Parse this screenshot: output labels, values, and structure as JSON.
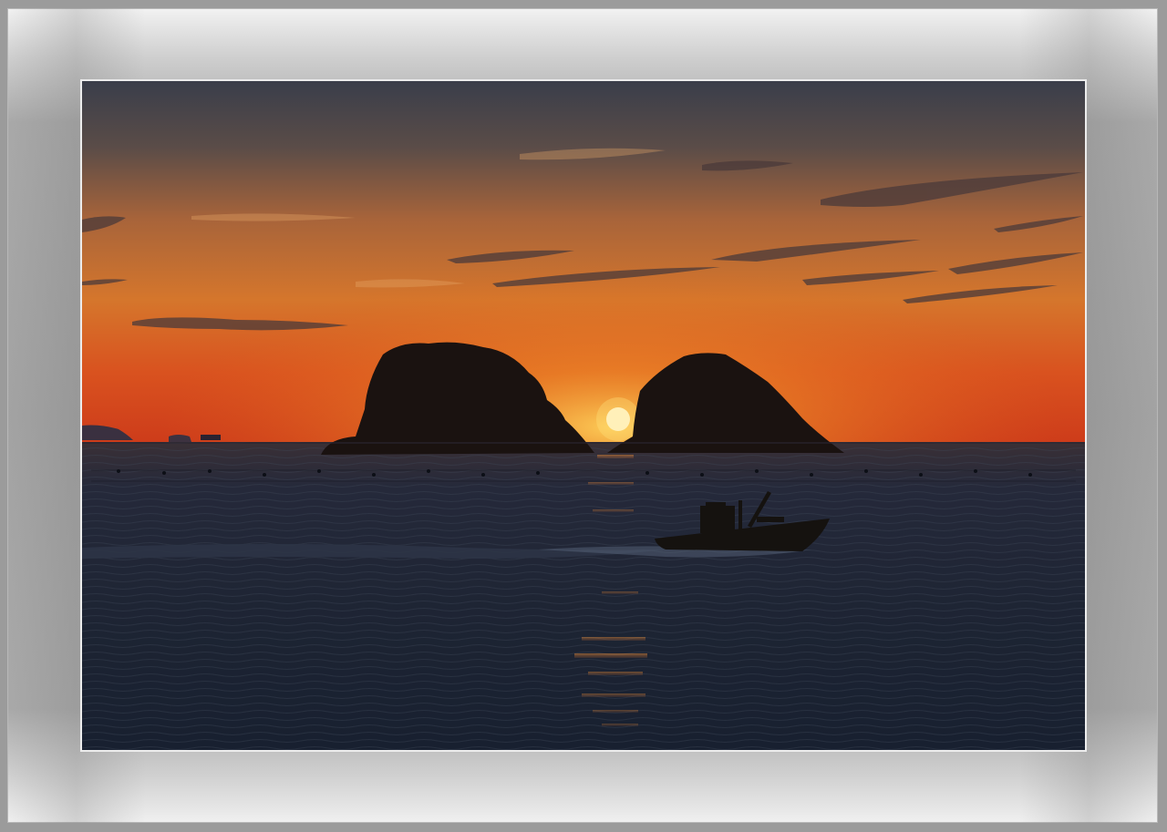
{
  "photo": {
    "subject": "sunset-over-sea-with-two-islands-and-fishing-boat",
    "colors": {
      "sky_top": "#3b3f4a",
      "sky_mid": "#c3652a",
      "sky_horizon": "#e2461c",
      "sun": "#fff6d6",
      "sea": "#1d2534",
      "silhouette": "#1a1210",
      "mat": "#a6a6a6",
      "inner_border": "#ececec"
    }
  }
}
